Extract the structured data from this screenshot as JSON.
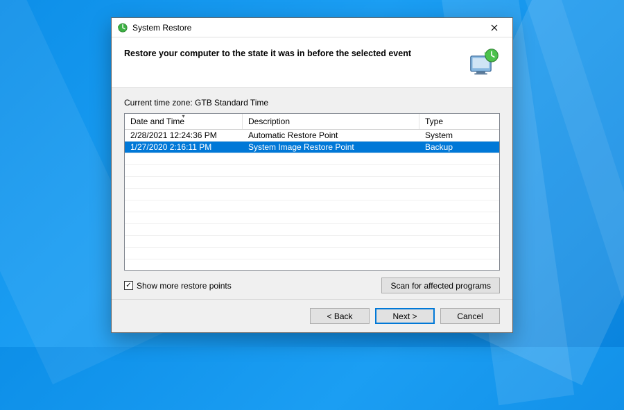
{
  "window": {
    "title": "System Restore"
  },
  "header": {
    "heading": "Restore your computer to the state it was in before the selected event"
  },
  "timezone": {
    "label": "Current time zone: GTB Standard Time"
  },
  "table": {
    "columns": {
      "datetime": "Date and Time",
      "description": "Description",
      "type": "Type"
    },
    "sort_column": "datetime",
    "sort_dir": "desc",
    "rows": [
      {
        "datetime": "2/28/2021 12:24:36 PM",
        "description": "Automatic Restore Point",
        "type": "System",
        "selected": false
      },
      {
        "datetime": "1/27/2020 2:16:11 PM",
        "description": "System Image Restore Point",
        "type": "Backup",
        "selected": true
      }
    ]
  },
  "show_more": {
    "checked": true,
    "label": "Show more restore points"
  },
  "buttons": {
    "scan": "Scan for affected programs",
    "back": "< Back",
    "next": "Next >",
    "cancel": "Cancel"
  }
}
